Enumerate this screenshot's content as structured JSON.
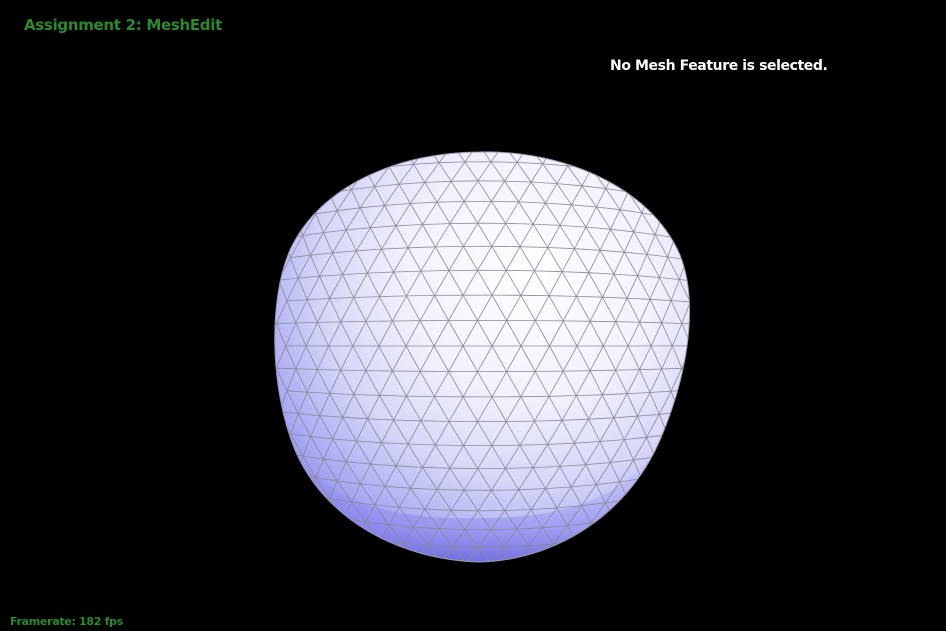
{
  "app": {
    "title": "Assignment 2: MeshEdit"
  },
  "status": {
    "selection_text": "No Mesh Feature is selected."
  },
  "footer": {
    "framerate_label": "Framerate:",
    "framerate_value": "182",
    "framerate_unit": "fps"
  },
  "colors": {
    "background": "#000000",
    "title_green": "#2c8a2c",
    "status_white": "#ffffff",
    "mesh_highlight": "#ffffff",
    "mesh_mid": "#c9c9f7",
    "mesh_shadow": "#7a78f0",
    "mesh_wire": "#8a8a9a"
  },
  "viewport": {
    "object": "triangulated-mesh-blob",
    "render_mode": "shaded-with-wireframe"
  }
}
